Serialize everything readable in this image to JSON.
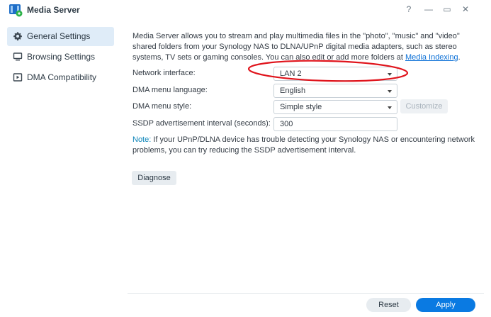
{
  "window": {
    "title": "Media Server",
    "help_glyph": "?",
    "minimize_glyph": "—",
    "maximize_glyph": "▭",
    "close_glyph": "✕"
  },
  "sidebar": {
    "items": [
      {
        "label": "General Settings",
        "icon": "gear-icon",
        "active": true
      },
      {
        "label": "Browsing Settings",
        "icon": "monitor-icon",
        "active": false
      },
      {
        "label": "DMA Compatibility",
        "icon": "play-icon",
        "active": false
      }
    ]
  },
  "main": {
    "description_text": "Media Server allows you to stream and play multimedia files in the \"photo\", \"music\" and \"video\" shared folders from your Synology NAS to DLNA/UPnP digital media adapters, such as stereo systems, TV sets or gaming consoles. You can also edit or add more folders at ",
    "description_link": "Media Indexing",
    "description_end": ".",
    "network_interface": {
      "label": "Network interface:",
      "value": "LAN 2"
    },
    "dma_language": {
      "label": "DMA menu language:",
      "value": "English"
    },
    "dma_style": {
      "label": "DMA menu style:",
      "value": "Simple style",
      "customize_label": "Customize"
    },
    "ssdp": {
      "label": "SSDP advertisement interval (seconds):",
      "value": "300"
    },
    "note_key": "Note:",
    "note_text": " If your UPnP/DLNA device has trouble detecting your Synology NAS or encountering network problems, you can try reducing the SSDP advertisement interval.",
    "diagnose_label": "Diagnose"
  },
  "footer": {
    "reset_label": "Reset",
    "apply_label": "Apply"
  },
  "colors": {
    "accent": "#0a7ae2",
    "sidebar_active": "#dfecf8",
    "annotation": "#e0141c"
  }
}
